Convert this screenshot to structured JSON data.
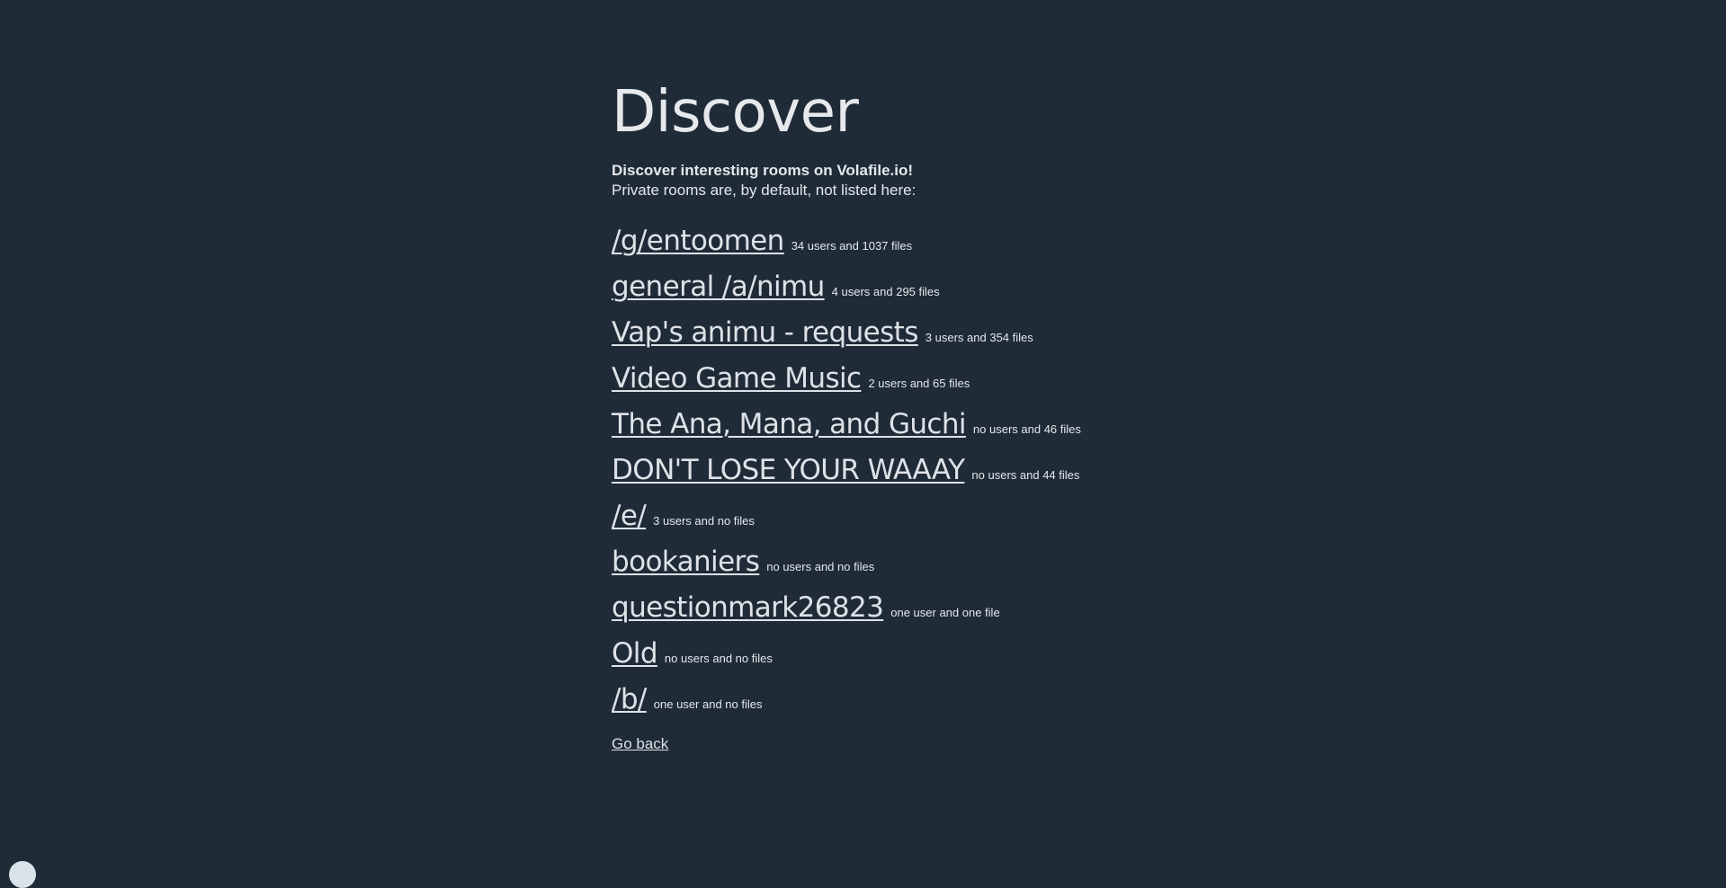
{
  "page": {
    "title": "Discover",
    "intro_lead": "Discover interesting rooms on Volafile.io!",
    "intro_sub": "Private rooms are, by default, not listed here:"
  },
  "rooms": [
    {
      "name": "/g/entoomen",
      "stats": "34 users and 1037 files"
    },
    {
      "name": "general /a/nimu",
      "stats": "4 users and 295 files"
    },
    {
      "name": "Vap's animu - requests",
      "stats": "3 users and 354 files"
    },
    {
      "name": "Video Game Music",
      "stats": "2 users and 65 files"
    },
    {
      "name": "The Ana, Mana, and Guchi",
      "stats": "no users and 46 files"
    },
    {
      "name": "DON'T LOSE YOUR WAAAY",
      "stats": "no users and 44 files"
    },
    {
      "name": "/e/",
      "stats": "3 users and no files"
    },
    {
      "name": "bookaniers",
      "stats": "no users and no files"
    },
    {
      "name": "questionmark26823",
      "stats": "one user and one file"
    },
    {
      "name": "Old",
      "stats": "no users and no files"
    },
    {
      "name": "/b/",
      "stats": "one user and no files"
    }
  ],
  "footer": {
    "go_back_label": "Go back"
  },
  "colors": {
    "background": "#1f2b37",
    "text": "#e4e8ec"
  }
}
